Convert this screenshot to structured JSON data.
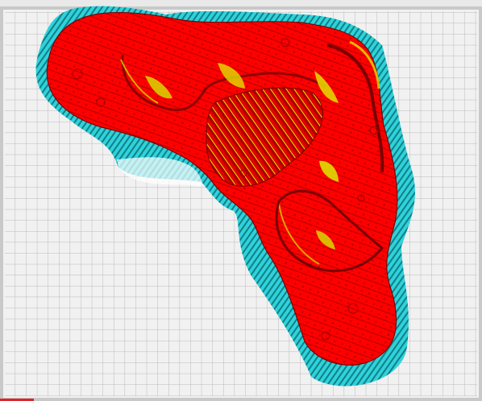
{
  "viewport": {
    "label": "",
    "colors": {
      "background": "#d4d4d4",
      "plate": "#f2f2f2",
      "plate_border": "#c9c9c9",
      "grid_line": "#b7b7b7",
      "model": "#ff0000",
      "model_shadow": "#b30000",
      "overhang": "#e6e600",
      "support": "#24c8d0",
      "support_dark": "#0f7e86",
      "axis_x": "#d8262b"
    },
    "icons": [
      "build-plate",
      "model-mesh",
      "support-structure",
      "x-axis-marker"
    ]
  }
}
